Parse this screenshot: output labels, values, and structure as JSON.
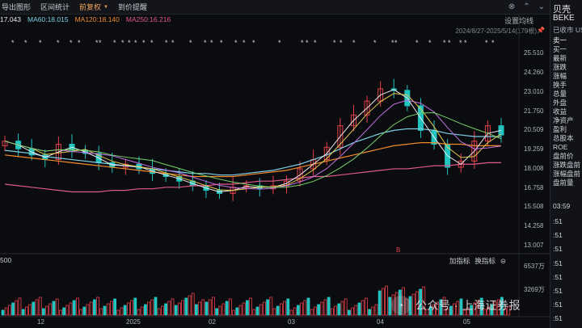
{
  "toolbar": {
    "items": [
      {
        "label": "导出图形",
        "active": false
      },
      {
        "label": "区间统计",
        "active": false
      },
      {
        "label": "前复权",
        "active": true
      },
      {
        "label": "到价提醒",
        "active": false
      }
    ],
    "indicator_label": "设置均线",
    "date_range": "2024/8/27-2025/5/14(179根)"
  },
  "ma_row": {
    "ma5": "17.043",
    "ma60": "MA60:18.015",
    "ma120": "MA120:18.140",
    "ma250": "MA250:16.216"
  },
  "price_ticks": [
    "25.510",
    "24.260",
    "23.010",
    "21.750",
    "20.509",
    "19.259",
    "18.008",
    "16.758",
    "15.508",
    "14.258",
    "13.007"
  ],
  "volume": {
    "left_label": "500",
    "buttons": [
      "加指标",
      "换指标"
    ],
    "ticks": [
      "6537万",
      "3269万"
    ]
  },
  "date_axis": [
    "12",
    "2025",
    "02",
    "03",
    "04",
    "05"
  ],
  "marker": "B",
  "watermark": "公众号 · 上海证券报",
  "right_panel": {
    "name": "贝壳",
    "symbol": "BEKE",
    "close_label": "已收市 US",
    "rows": [
      "卖一",
      "买一",
      "最新",
      "涨跌",
      "涨幅",
      "换手",
      "总量",
      "外盘",
      "收益",
      "净资产",
      "盈利",
      "总股本",
      "ROE",
      "盘前价",
      "涨跌盘前",
      "涨幅盘前",
      "盘前量"
    ],
    "time": "03:59",
    "tick_rows": [
      ":51",
      ":51",
      ":51",
      ":51",
      ":51",
      ":51",
      ":51",
      ":51",
      ":51"
    ]
  },
  "colors": {
    "up": "#e5414a",
    "down": "#22c4c0",
    "ma5": "#e9e9e9",
    "ma10": "#e5c94e",
    "ma20": "#c070e0",
    "ma30": "#78d26a",
    "ma60": "#7fd0e6",
    "ma120": "#f08a2c",
    "ma250": "#e0588a"
  },
  "chart_data": {
    "type": "candlestick",
    "ylim": [
      13.007,
      25.51
    ],
    "x": [
      "2024-08-27",
      "2024-09-03",
      "2024-09-10",
      "2024-09-17",
      "2024-09-24",
      "2024-10-01",
      "2024-10-08",
      "2024-10-15",
      "2024-10-22",
      "2024-10-29",
      "2024-11-05",
      "2024-11-12",
      "2024-11-19",
      "2024-11-26",
      "2024-12-03",
      "2024-12-10",
      "2024-12-17",
      "2024-12-24",
      "2024-12-31",
      "2025-01-07",
      "2025-01-14",
      "2025-01-21",
      "2025-01-28",
      "2025-02-04",
      "2025-02-11",
      "2025-02-18",
      "2025-02-25",
      "2025-03-04",
      "2025-03-11",
      "2025-03-18",
      "2025-03-25",
      "2025-04-01",
      "2025-04-08",
      "2025-04-15",
      "2025-04-22",
      "2025-04-29",
      "2025-05-06",
      "2025-05-13"
    ],
    "close": [
      19.8,
      19.3,
      18.9,
      18.6,
      19.6,
      19.2,
      19.0,
      18.4,
      18.1,
      18.3,
      18.0,
      17.7,
      17.5,
      17.2,
      16.9,
      16.6,
      16.4,
      16.8,
      16.9,
      16.7,
      16.9,
      17.2,
      18.0,
      18.6,
      19.4,
      20.8,
      21.5,
      22.4,
      23.2,
      23.1,
      22.1,
      20.5,
      19.6,
      18.1,
      18.5,
      19.8,
      20.8,
      20.2
    ],
    "series": [
      {
        "name": "MA60",
        "values": [
          19.2,
          19.1,
          19.0,
          18.8,
          18.7,
          18.6,
          18.5,
          18.4,
          18.3,
          18.2,
          18.1,
          18.0,
          17.9,
          17.8,
          17.7,
          17.7,
          17.6,
          17.6,
          17.7,
          17.8,
          17.9,
          18.1,
          18.3,
          18.6,
          18.9,
          19.3,
          19.7,
          20.0,
          20.3,
          20.5,
          20.6,
          20.6,
          20.5,
          20.3,
          20.2,
          20.1,
          20.1,
          20.1
        ]
      },
      {
        "name": "MA120",
        "values": [
          18.9,
          18.8,
          18.7,
          18.6,
          18.5,
          18.4,
          18.3,
          18.2,
          18.1,
          18.0,
          17.9,
          17.8,
          17.7,
          17.6,
          17.5,
          17.5,
          17.5,
          17.5,
          17.6,
          17.7,
          17.8,
          17.9,
          18.1,
          18.3,
          18.5,
          18.7,
          18.9,
          19.1,
          19.3,
          19.5,
          19.6,
          19.7,
          19.7,
          19.6,
          19.6,
          19.5,
          19.5,
          19.5
        ]
      },
      {
        "name": "MA250",
        "values": [
          17.0,
          16.9,
          16.8,
          16.7,
          16.6,
          16.5,
          16.5,
          16.5,
          16.6,
          16.6,
          16.7,
          16.7,
          16.8,
          16.8,
          16.9,
          16.9,
          17.0,
          17.0,
          17.1,
          17.2,
          17.2,
          17.3,
          17.4,
          17.5,
          17.5,
          17.6,
          17.7,
          17.8,
          17.9,
          18.0,
          18.0,
          18.1,
          18.2,
          18.2,
          18.3,
          18.3,
          18.4,
          18.4
        ]
      }
    ]
  }
}
